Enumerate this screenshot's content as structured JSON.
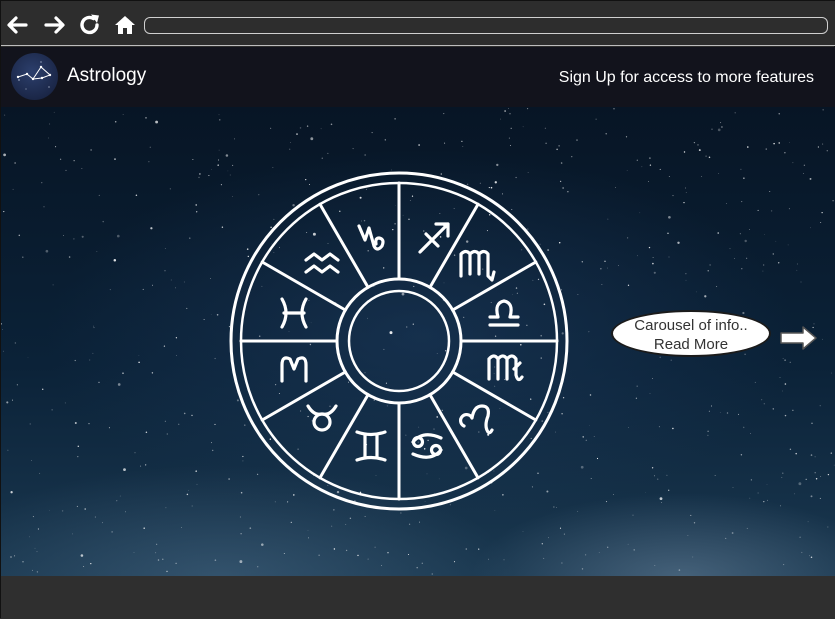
{
  "browser": {
    "icons": [
      "back-arrow-icon",
      "forward-arrow-icon",
      "reload-icon",
      "home-icon"
    ],
    "address_value": ""
  },
  "header": {
    "logo_icon": "constellation-icon",
    "title": "Astrology",
    "signup_label": "Sign Up for access to more features"
  },
  "hero": {
    "image": "zodiac-wheel-on-starry-sky",
    "zodiac_signs": [
      "Aquarius",
      "Capricorn",
      "Sagittarius",
      "Scorpio",
      "Libra",
      "Virgo",
      "Leo",
      "Cancer",
      "Gemini",
      "Taurus",
      "Aries",
      "Pisces"
    ],
    "carousel": {
      "line1": "Carousel of info..",
      "line2": "Read More"
    },
    "next_icon": "right-arrow-icon"
  },
  "colors": {
    "chrome": "#2d2d2d",
    "header": "#12131c",
    "sky": "#0b2238",
    "footer": "#2f2f2f",
    "text": "#ffffff"
  }
}
